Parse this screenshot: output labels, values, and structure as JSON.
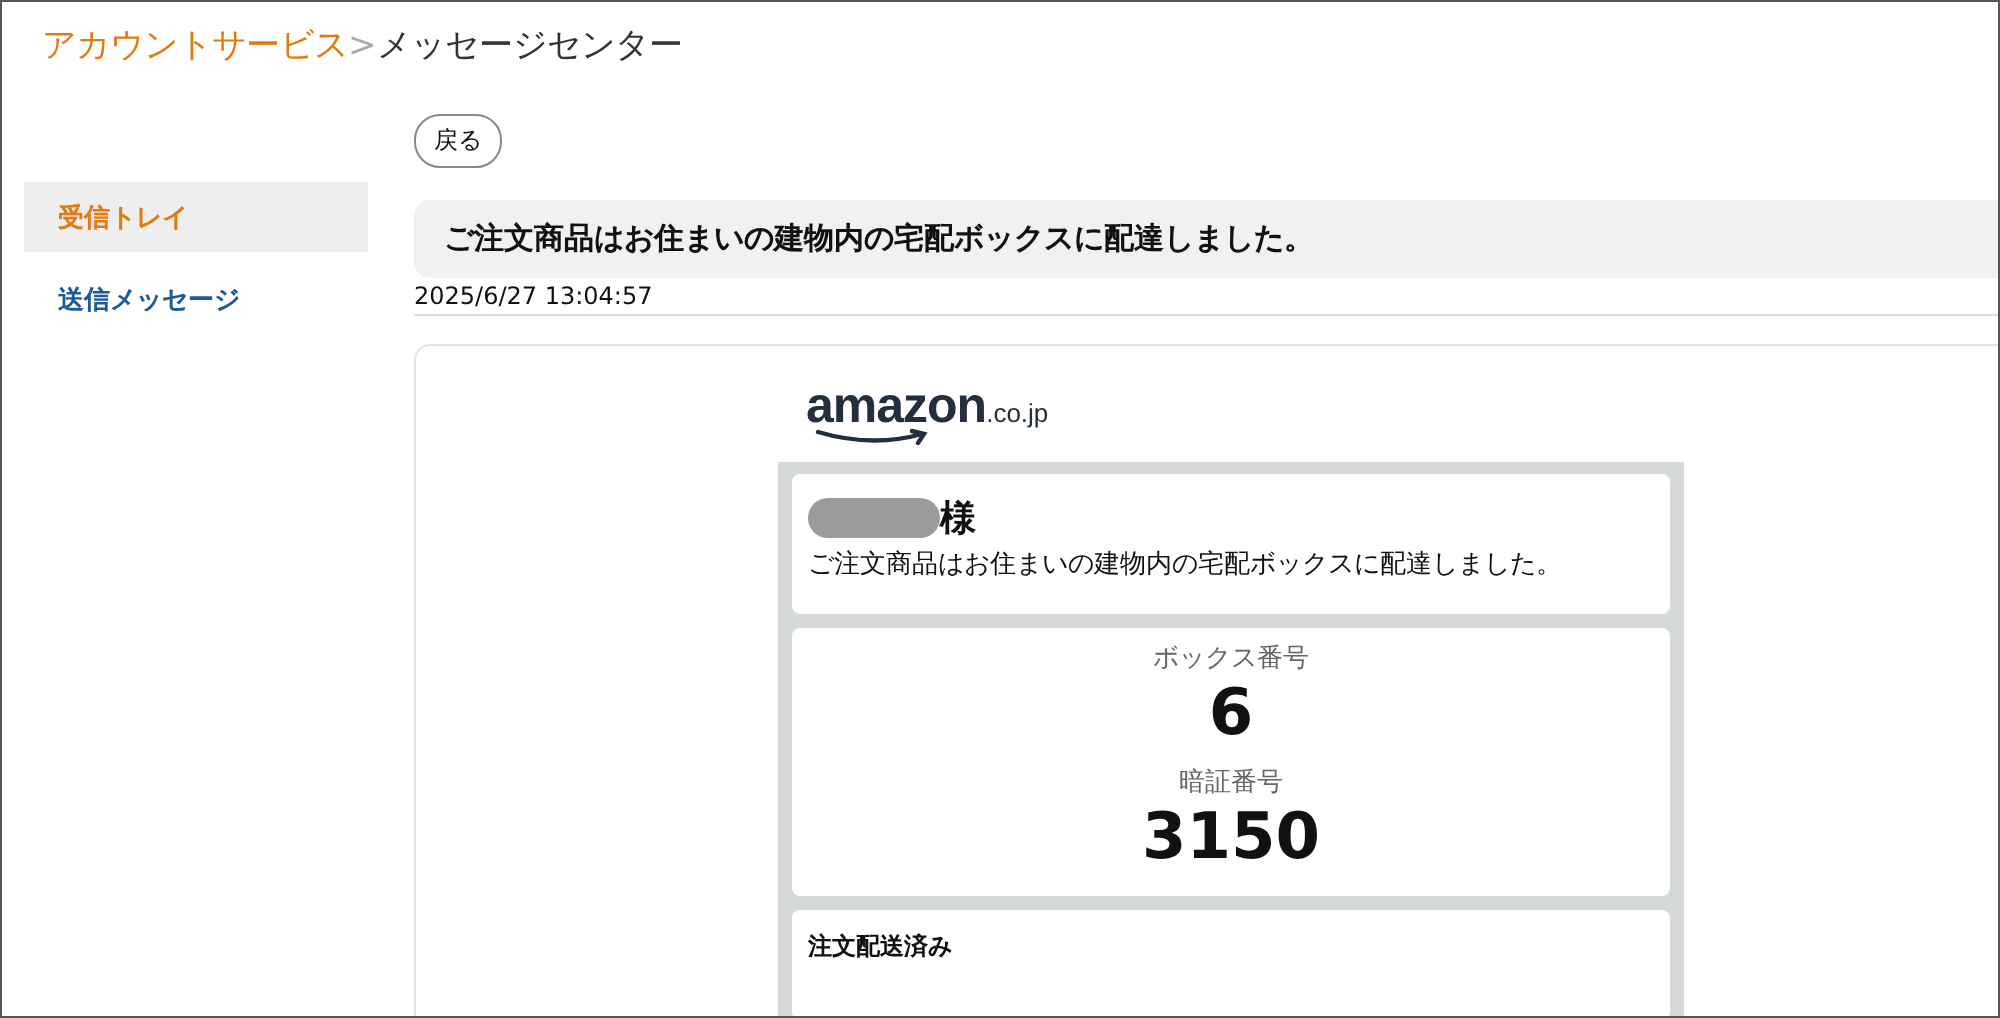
{
  "breadcrumb": {
    "parent": "アカウントサービス",
    "separator": ">",
    "current": "メッセージセンター"
  },
  "back_button": "戻る",
  "sidebar": {
    "items": [
      {
        "label": "受信トレイ",
        "selected": true
      },
      {
        "label": "送信メッセージ",
        "selected": false
      }
    ]
  },
  "message": {
    "subject": "ご注文商品はお住まいの建物内の宅配ボックスに配達しました。",
    "date": "2025/6/27 13:04:57",
    "logo": {
      "word": "amazon",
      "domain": ".co.jp"
    },
    "greeting": {
      "honorific": "様",
      "body": "ご注文商品はお住まいの建物内の宅配ボックスに配達しました。"
    },
    "codes": [
      {
        "label": "ボックス番号",
        "value": "6"
      },
      {
        "label": "暗証番号",
        "value": "3150"
      }
    ],
    "status_heading": "注文配送済み"
  }
}
